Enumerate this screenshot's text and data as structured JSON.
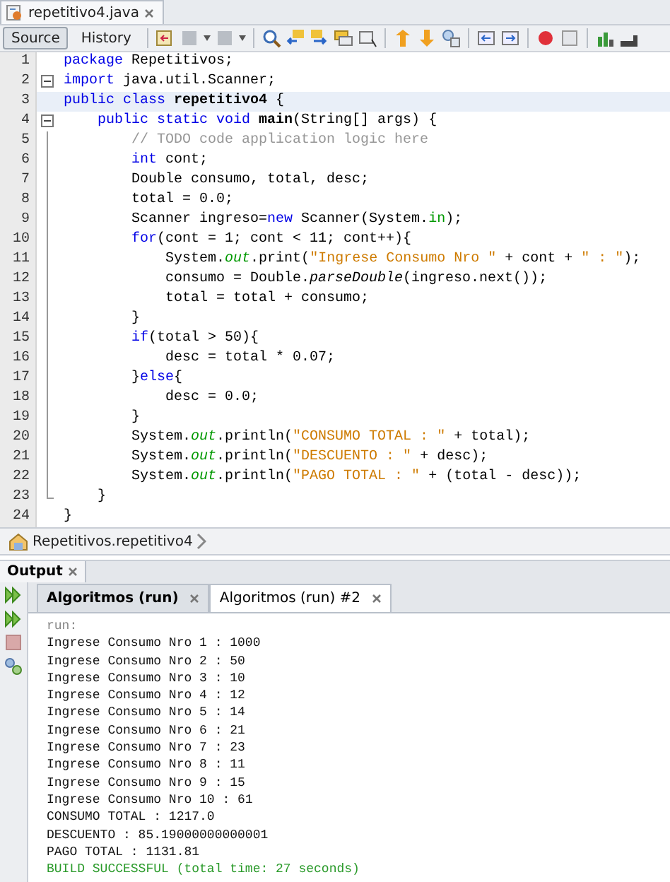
{
  "editor_tab": {
    "title": "repetitivo4.java",
    "selected": true
  },
  "view_tabs": [
    {
      "label": "Source",
      "selected": true
    },
    {
      "label": "History",
      "selected": false
    }
  ],
  "code": [
    {
      "number": "1",
      "kind": "plain",
      "current": false,
      "tokens": [
        {
          "kind": "kw",
          "text": "package"
        },
        {
          "kind": "plain",
          "text": " Repetitivos;"
        }
      ]
    },
    {
      "number": "2",
      "kind": "fold-start",
      "current": false,
      "tokens": [
        {
          "kind": "kw",
          "text": "import"
        },
        {
          "kind": "plain",
          "text": " java.util.Scanner;"
        }
      ]
    },
    {
      "number": "3",
      "kind": "plain",
      "current": true,
      "tokens": [
        {
          "kind": "kw",
          "text": "public class"
        },
        {
          "kind": "bold",
          "text": " repetitivo4"
        },
        {
          "kind": "plain",
          "text": " {"
        }
      ]
    },
    {
      "number": "4",
      "kind": "fold-start",
      "current": false,
      "tokens": [
        {
          "kind": "kw",
          "text": "    public static void"
        },
        {
          "kind": "bold",
          "text": " main"
        },
        {
          "kind": "plain",
          "text": "(String[] args) {"
        }
      ]
    },
    {
      "number": "5",
      "kind": "fold-body",
      "current": false,
      "tokens": [
        {
          "kind": "cmt",
          "text": "        // TODO code application logic here"
        }
      ]
    },
    {
      "number": "6",
      "kind": "fold-body",
      "current": false,
      "tokens": [
        {
          "kind": "kw",
          "text": "        int"
        },
        {
          "kind": "plain",
          "text": " cont;"
        }
      ]
    },
    {
      "number": "7",
      "kind": "fold-body",
      "current": false,
      "tokens": [
        {
          "kind": "plain",
          "text": "        Double consumo, total, desc;"
        }
      ]
    },
    {
      "number": "8",
      "kind": "fold-body",
      "current": false,
      "tokens": [
        {
          "kind": "plain",
          "text": "        total = 0.0;"
        }
      ]
    },
    {
      "number": "9",
      "kind": "fold-body",
      "current": false,
      "tokens": [
        {
          "kind": "plain",
          "text": "        Scanner ingreso="
        },
        {
          "kind": "kw",
          "text": "new"
        },
        {
          "kind": "plain",
          "text": " Scanner(System."
        },
        {
          "kind": "field",
          "text": "in"
        },
        {
          "kind": "plain",
          "text": ");"
        }
      ]
    },
    {
      "number": "10",
      "kind": "fold-body",
      "current": false,
      "tokens": [
        {
          "kind": "kw",
          "text": "        for"
        },
        {
          "kind": "plain",
          "text": "(cont = 1; cont < 11; cont++){"
        }
      ]
    },
    {
      "number": "11",
      "kind": "fold-body",
      "current": false,
      "tokens": [
        {
          "kind": "plain",
          "text": "            System."
        },
        {
          "kind": "field-italic",
          "text": "out"
        },
        {
          "kind": "plain",
          "text": ".print("
        },
        {
          "kind": "str",
          "text": "\"Ingrese Consumo Nro \""
        },
        {
          "kind": "plain",
          "text": " + cont + "
        },
        {
          "kind": "str",
          "text": "\" : \""
        },
        {
          "kind": "plain",
          "text": ");"
        }
      ]
    },
    {
      "number": "12",
      "kind": "fold-body",
      "current": false,
      "tokens": [
        {
          "kind": "plain",
          "text": "            consumo = Double."
        },
        {
          "kind": "italic",
          "text": "parseDouble"
        },
        {
          "kind": "plain",
          "text": "(ingreso.next());"
        }
      ]
    },
    {
      "number": "13",
      "kind": "fold-body",
      "current": false,
      "tokens": [
        {
          "kind": "plain",
          "text": "            total = total + consumo;"
        }
      ]
    },
    {
      "number": "14",
      "kind": "fold-body",
      "current": false,
      "tokens": [
        {
          "kind": "plain",
          "text": "        }"
        }
      ]
    },
    {
      "number": "15",
      "kind": "fold-body",
      "current": false,
      "tokens": [
        {
          "kind": "kw",
          "text": "        if"
        },
        {
          "kind": "plain",
          "text": "(total > 50){"
        }
      ]
    },
    {
      "number": "16",
      "kind": "fold-body",
      "current": false,
      "tokens": [
        {
          "kind": "plain",
          "text": "            desc = total * 0.07;"
        }
      ]
    },
    {
      "number": "17",
      "kind": "fold-body",
      "current": false,
      "tokens": [
        {
          "kind": "plain",
          "text": "        }"
        },
        {
          "kind": "kw",
          "text": "else"
        },
        {
          "kind": "plain",
          "text": "{"
        }
      ]
    },
    {
      "number": "18",
      "kind": "fold-body",
      "current": false,
      "tokens": [
        {
          "kind": "plain",
          "text": "            desc = 0.0;"
        }
      ]
    },
    {
      "number": "19",
      "kind": "fold-body",
      "current": false,
      "tokens": [
        {
          "kind": "plain",
          "text": "        }"
        }
      ]
    },
    {
      "number": "20",
      "kind": "fold-body",
      "current": false,
      "tokens": [
        {
          "kind": "plain",
          "text": "        System."
        },
        {
          "kind": "field-italic",
          "text": "out"
        },
        {
          "kind": "plain",
          "text": ".println("
        },
        {
          "kind": "str",
          "text": "\"CONSUMO TOTAL : \""
        },
        {
          "kind": "plain",
          "text": " + total);"
        }
      ]
    },
    {
      "number": "21",
      "kind": "fold-body",
      "current": false,
      "tokens": [
        {
          "kind": "plain",
          "text": "        System."
        },
        {
          "kind": "field-italic",
          "text": "out"
        },
        {
          "kind": "plain",
          "text": ".println("
        },
        {
          "kind": "str",
          "text": "\"DESCUENTO : \""
        },
        {
          "kind": "plain",
          "text": " + desc);"
        }
      ]
    },
    {
      "number": "22",
      "kind": "fold-body",
      "current": false,
      "tokens": [
        {
          "kind": "plain",
          "text": "        System."
        },
        {
          "kind": "field-italic",
          "text": "out"
        },
        {
          "kind": "plain",
          "text": ".println("
        },
        {
          "kind": "str",
          "text": "\"PAGO TOTAL : \""
        },
        {
          "kind": "plain",
          "text": " + (total - desc));"
        }
      ]
    },
    {
      "number": "23",
      "kind": "fold-end",
      "current": false,
      "tokens": [
        {
          "kind": "plain",
          "text": "    }"
        }
      ]
    },
    {
      "number": "24",
      "kind": "plain",
      "current": false,
      "tokens": [
        {
          "kind": "plain",
          "text": "}"
        }
      ]
    }
  ],
  "breadcrumb": "Repetitivos.repetitivo4",
  "output": {
    "title": "Output",
    "tabs": [
      {
        "label": "Algoritmos (run)",
        "selected": false,
        "bold": true
      },
      {
        "label": "Algoritmos (run) #2",
        "selected": true,
        "bold": false
      }
    ],
    "lines": [
      {
        "kind": "info",
        "text": "run:"
      },
      {
        "kind": "normal",
        "text": "Ingrese Consumo Nro 1 : 1000"
      },
      {
        "kind": "normal",
        "text": "Ingrese Consumo Nro 2 : 50"
      },
      {
        "kind": "normal",
        "text": "Ingrese Consumo Nro 3 : 10"
      },
      {
        "kind": "normal",
        "text": "Ingrese Consumo Nro 4 : 12"
      },
      {
        "kind": "normal",
        "text": "Ingrese Consumo Nro 5 : 14"
      },
      {
        "kind": "normal",
        "text": "Ingrese Consumo Nro 6 : 21"
      },
      {
        "kind": "normal",
        "text": "Ingrese Consumo Nro 7 : 23"
      },
      {
        "kind": "normal",
        "text": "Ingrese Consumo Nro 8 : 11"
      },
      {
        "kind": "normal",
        "text": "Ingrese Consumo Nro 9 : 15"
      },
      {
        "kind": "normal",
        "text": "Ingrese Consumo Nro 10 : 61"
      },
      {
        "kind": "normal",
        "text": "CONSUMO TOTAL : 1217.0"
      },
      {
        "kind": "normal",
        "text": "DESCUENTO : 85.19000000000001"
      },
      {
        "kind": "normal",
        "text": "PAGO TOTAL : 1131.81"
      },
      {
        "kind": "success",
        "text": "BUILD SUCCESSFUL (total time: 27 seconds)"
      }
    ]
  }
}
